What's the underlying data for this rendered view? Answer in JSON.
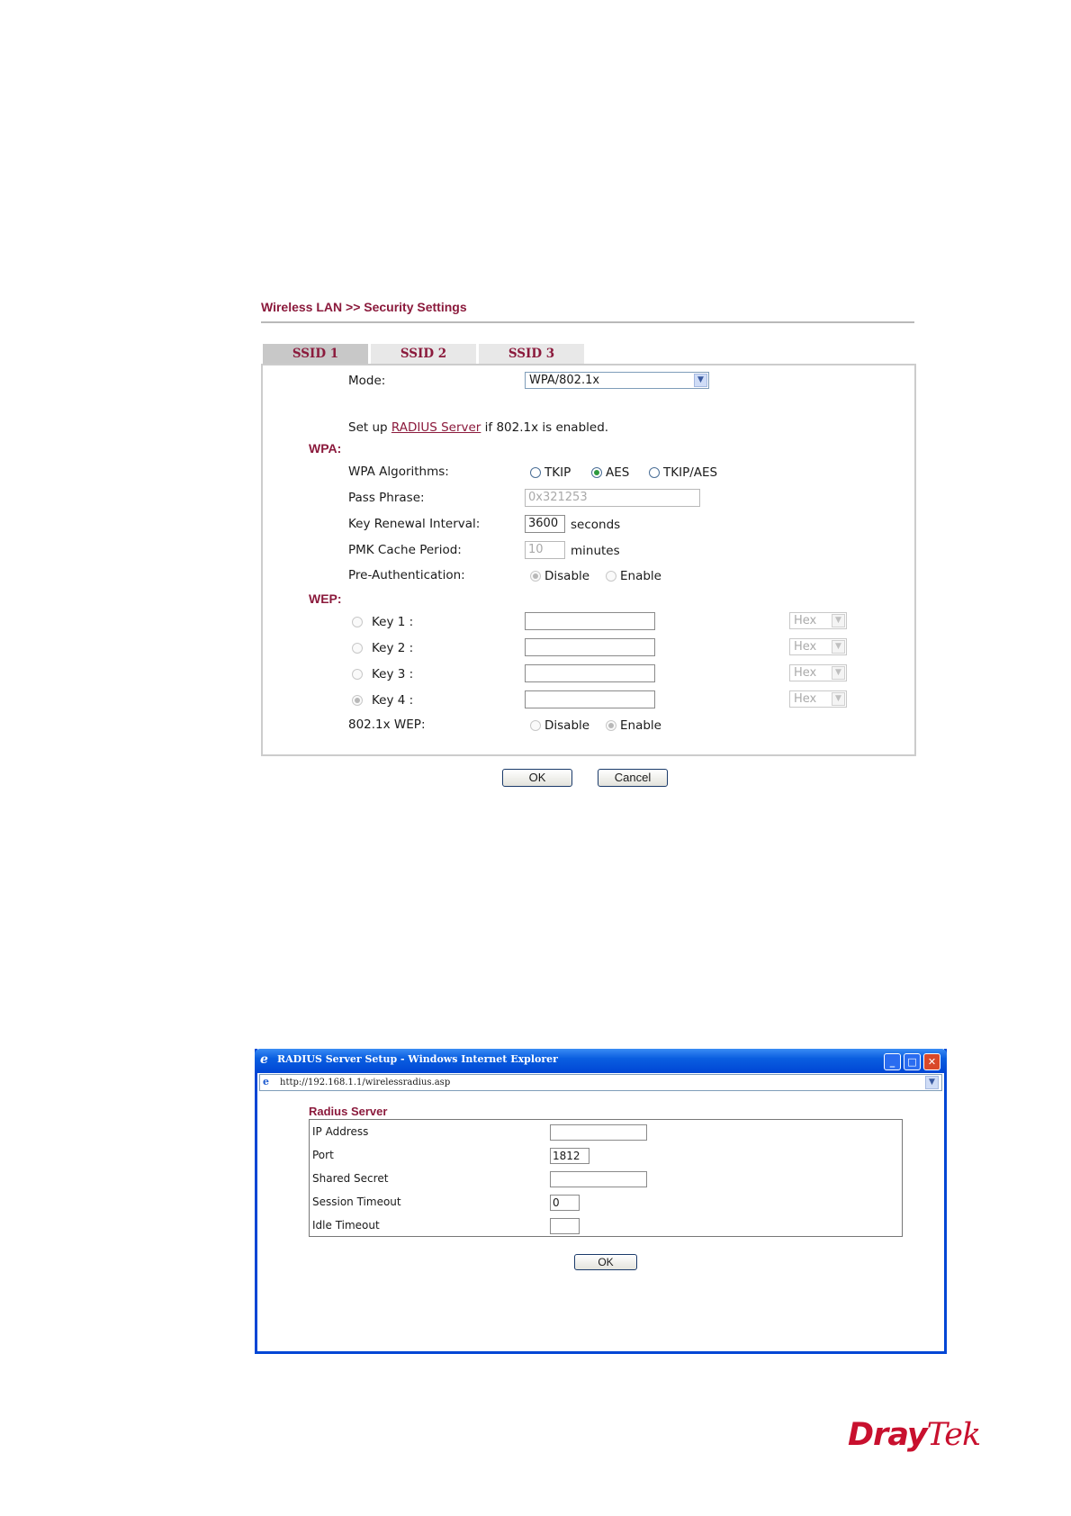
{
  "breadcrumb": "Wireless LAN >> Security Settings",
  "tabs": [
    {
      "label": "SSID 1",
      "active": true
    },
    {
      "label": "SSID 2",
      "active": false
    },
    {
      "label": "SSID 3",
      "active": false
    }
  ],
  "mode": {
    "label": "Mode:",
    "value": "WPA/802.1x"
  },
  "radius_note": {
    "prefix": "Set up ",
    "link": "RADIUS Server",
    "suffix": " if 802.1x is enabled."
  },
  "wpa": {
    "title": "WPA:",
    "algorithms": {
      "label": "WPA Algorithms:",
      "options": [
        "TKIP",
        "AES",
        "TKIP/AES"
      ],
      "selected": "AES"
    },
    "pass_phrase": {
      "label": "Pass Phrase:",
      "value": "0x321253"
    },
    "key_renewal": {
      "label": "Key Renewal Interval:",
      "value": "3600",
      "unit": "seconds"
    },
    "pmk_cache": {
      "label": "PMK Cache Period:",
      "value": "10",
      "unit": "minutes"
    },
    "pre_auth": {
      "label": "Pre-Authentication:",
      "options": [
        "Disable",
        "Enable"
      ],
      "selected": "Disable"
    }
  },
  "wep": {
    "title": "WEP:",
    "keys": [
      {
        "label": "Key 1 :",
        "value": "",
        "format": "Hex",
        "selected": false
      },
      {
        "label": "Key 2 :",
        "value": "",
        "format": "Hex",
        "selected": false
      },
      {
        "label": "Key 3 :",
        "value": "",
        "format": "Hex",
        "selected": false
      },
      {
        "label": "Key 4 :",
        "value": "",
        "format": "Hex",
        "selected": true
      }
    ],
    "wep_8021x": {
      "label": "802.1x WEP:",
      "options": [
        "Disable",
        "Enable"
      ],
      "selected": "Enable"
    }
  },
  "buttons": {
    "ok": "OK",
    "cancel": "Cancel"
  },
  "popup": {
    "title": "RADIUS Server Setup - Windows Internet Explorer",
    "url": "http://192.168.1.1/wirelessradius.asp",
    "section_title": "Radius Server",
    "fields": [
      {
        "label": "IP Address",
        "value": ""
      },
      {
        "label": "Port",
        "value": "1812"
      },
      {
        "label": "Shared Secret",
        "value": ""
      },
      {
        "label": "Session Timeout",
        "value": "0"
      },
      {
        "label": "Idle Timeout",
        "value": ""
      }
    ],
    "ok": "OK"
  },
  "logo": {
    "part1": "Dray",
    "part2": "Tek"
  },
  "colors": {
    "accent": "#8b1a3c",
    "radio_selected": "#2e9a3e",
    "window_blue": "#0046d5",
    "logo_red": "#c8102e"
  }
}
